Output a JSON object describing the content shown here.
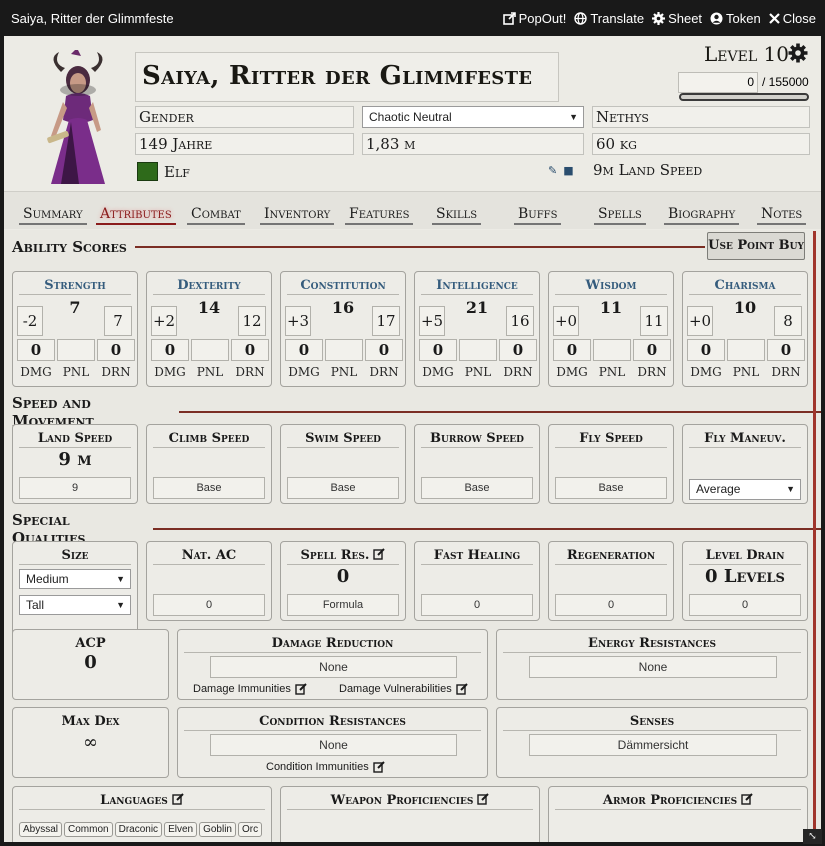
{
  "window": {
    "title": "Saiya, Ritter der Glimmfeste",
    "actions": [
      {
        "label": "PopOut!",
        "icon": "popout-icon"
      },
      {
        "label": "Translate",
        "icon": "globe-icon"
      },
      {
        "label": "Sheet",
        "icon": "gear-icon"
      },
      {
        "label": "Token",
        "icon": "user-circle-icon"
      },
      {
        "label": "Close",
        "icon": "close-icon"
      }
    ]
  },
  "header": {
    "name": "Saiya, Ritter der Glimmfeste",
    "level": "Level 10",
    "xp_current": "0",
    "xp_max": "/ 155000",
    "xp_fraction": 0.0,
    "gender": "Gender",
    "alignment": "Chaotic Neutral",
    "deity": "Nethys",
    "age": "149 Jahre",
    "height": "1,83 m",
    "weight": "60 kg",
    "race": "Elf",
    "land_speed": "9m Land Speed"
  },
  "tabs": [
    "Summary",
    "Attributes",
    "Combat",
    "Inventory",
    "Features",
    "Skills",
    "Buffs",
    "Spells",
    "Biography",
    "Notes"
  ],
  "active_tab": "Attributes",
  "sections": {
    "ability_scores": "Ability Scores",
    "speed": "Speed and Movement",
    "special": "Special Qualities",
    "point_buy": "Use Point Buy"
  },
  "abilities": [
    {
      "name": "Strength",
      "score": "7",
      "mod": "-2",
      "temp": "7",
      "dmg": "0",
      "pnl": "",
      "drn": "0"
    },
    {
      "name": "Dexterity",
      "score": "14",
      "mod": "+2",
      "temp": "12",
      "dmg": "0",
      "pnl": "",
      "drn": "0"
    },
    {
      "name": "Constitution",
      "score": "16",
      "mod": "+3",
      "temp": "17",
      "dmg": "0",
      "pnl": "",
      "drn": "0"
    },
    {
      "name": "Intelligence",
      "score": "21",
      "mod": "+5",
      "temp": "16",
      "dmg": "0",
      "pnl": "",
      "drn": "0"
    },
    {
      "name": "Wisdom",
      "score": "11",
      "mod": "+0",
      "temp": "11",
      "dmg": "0",
      "pnl": "",
      "drn": "0"
    },
    {
      "name": "Charisma",
      "score": "10",
      "mod": "+0",
      "temp": "8",
      "dmg": "0",
      "pnl": "",
      "drn": "0"
    }
  ],
  "ability_labels": {
    "dmg": "DMG",
    "pnl": "PNL",
    "drn": "DRN"
  },
  "speeds": [
    {
      "name": "Land Speed",
      "value": "9 m",
      "input": "9"
    },
    {
      "name": "Climb Speed",
      "value": "",
      "input": "Base"
    },
    {
      "name": "Swim Speed",
      "value": "",
      "input": "Base"
    },
    {
      "name": "Burrow Speed",
      "value": "",
      "input": "Base"
    },
    {
      "name": "Fly Speed",
      "value": "",
      "input": "Base"
    },
    {
      "name": "Fly Maneuv.",
      "value": "",
      "input": "Average"
    }
  ],
  "qualities": {
    "size": {
      "title": "Size",
      "size": "Medium",
      "stature": "Tall"
    },
    "nat_ac": {
      "title": "Nat. AC",
      "input": "0"
    },
    "spell_res": {
      "title": "Spell Res.",
      "value": "0",
      "input": "Formula"
    },
    "fast_healing": {
      "title": "Fast Healing",
      "input": "0"
    },
    "regeneration": {
      "title": "Regeneration",
      "input": "0"
    },
    "level_drain": {
      "title": "Level Drain",
      "value": "0 Levels",
      "input": "0"
    },
    "acp": {
      "title": "ACP",
      "value": "0"
    },
    "damage_reduction": {
      "title": "Damage Reduction",
      "input": "None",
      "immunities": "Damage Immunities",
      "vulnerabilities": "Damage Vulnerabilities"
    },
    "energy_resistances": {
      "title": "Energy Resistances",
      "input": "None"
    },
    "max_dex": {
      "title": "Max Dex",
      "value": "∞"
    },
    "condition_resistances": {
      "title": "Condition Resistances",
      "input": "None",
      "immunities": "Condition Immunities"
    },
    "senses": {
      "title": "Senses",
      "input": "Dämmersicht"
    },
    "languages": {
      "title": "Languages",
      "items": [
        "Abyssal",
        "Common",
        "Draconic",
        "Elven",
        "Goblin",
        "Orc"
      ]
    },
    "weapon_prof": {
      "title": "Weapon Proficiencies"
    },
    "armor_prof": {
      "title": "Armor Proficiencies"
    }
  },
  "colors": {
    "accent": "#8a1c1c",
    "ability_title": "#355c7d",
    "scrollbar": "#a0352c"
  }
}
